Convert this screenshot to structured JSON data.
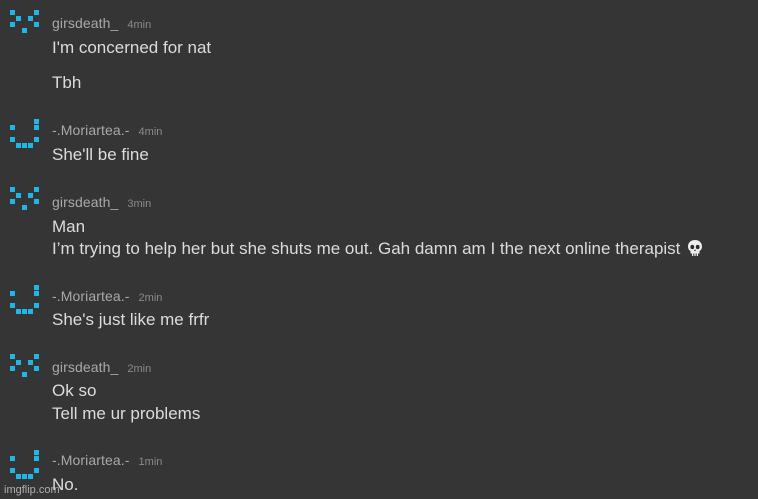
{
  "messages": [
    {
      "user": "girsdeath_",
      "time": "4min",
      "avatar": "pixel-x-face-icon",
      "lines": [
        "I'm concerned for nat",
        "Tbh"
      ]
    },
    {
      "user": "-.Moriartea.-",
      "time": "4min",
      "avatar": "pixel-smile-face-icon",
      "lines": [
        "She'll be fine"
      ]
    },
    {
      "user": "girsdeath_",
      "time": "3min",
      "avatar": "pixel-x-face-icon",
      "lines": [
        "Man",
        "I’m trying to help her but she shuts me out. Gah damn am I the next online therapist"
      ]
    },
    {
      "user": "-.Moriartea.-",
      "time": "2min",
      "avatar": "pixel-smile-face-icon",
      "lines": [
        "She's just like me frfr"
      ]
    },
    {
      "user": "girsdeath_",
      "time": "2min",
      "avatar": "pixel-x-face-icon",
      "lines": [
        "Ok so",
        "Tell me ur problems"
      ]
    },
    {
      "user": "-.Moriartea.-",
      "time": "1min",
      "avatar": "pixel-smile-face-icon",
      "lines": [
        "No."
      ]
    }
  ],
  "emoji": "skull-icon",
  "watermark": "imgflip.com",
  "colors": {
    "background": "#353535",
    "avatar_cyan": "#1fb6e8",
    "username": "#a9a9a9",
    "message_text": "#dcdcdc"
  }
}
